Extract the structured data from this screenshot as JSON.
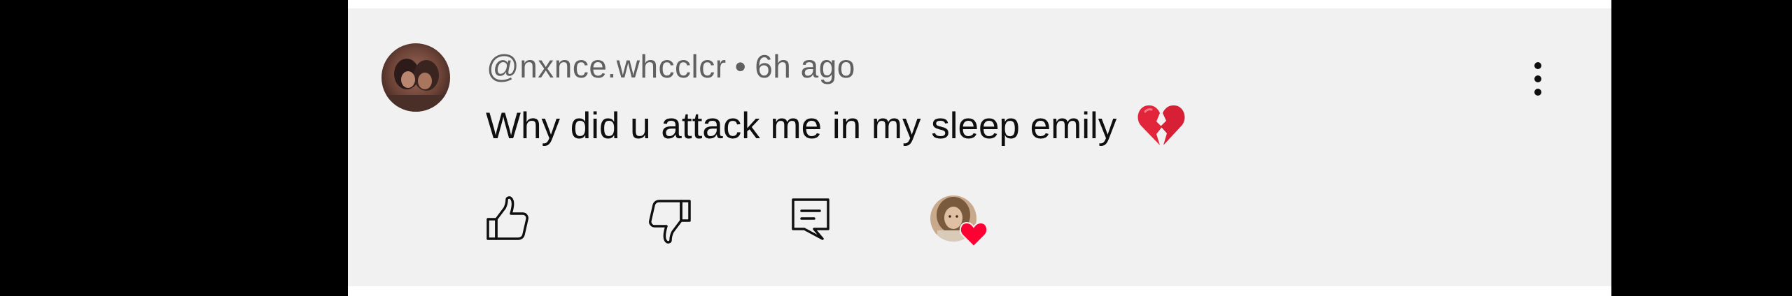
{
  "comment": {
    "author_handle": "@nxnce.whcclcr",
    "separator": "•",
    "time_ago": "6h ago",
    "text": "Why did u attack me in my sleep emily",
    "text_emoji_icon": "broken-heart-icon"
  },
  "actions": {
    "like_icon": "thumbs-up-icon",
    "dislike_icon": "thumbs-down-icon",
    "reply_icon": "reply-comment-icon",
    "creator_heart_icon": "creator-heart-icon",
    "more_icon": "more-vertical-icon"
  },
  "colors": {
    "card_background": "#f1f1f1",
    "primary_text": "#0f0f0f",
    "secondary_text": "#606060",
    "heart_red": "#ff0033",
    "page_background": "#000000"
  }
}
